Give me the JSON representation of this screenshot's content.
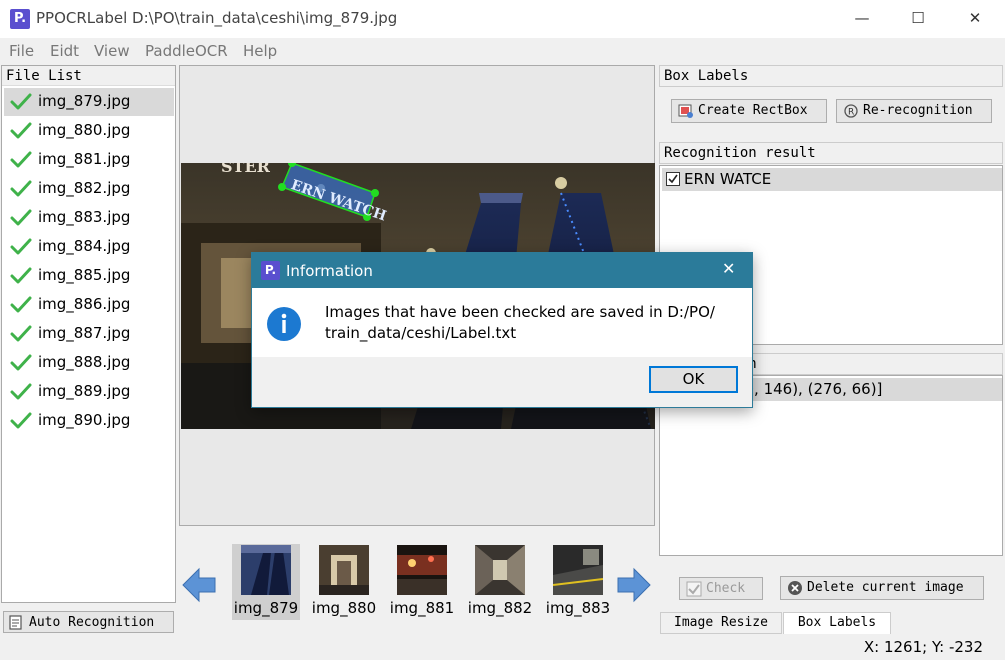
{
  "window": {
    "app_icon_text": "P.",
    "title": "PPOCRLabel D:\\PO\\train_data\\ceshi\\img_879.jpg",
    "minimize": "—",
    "maximize": "☐",
    "close": "✕"
  },
  "menu": [
    "File",
    "Eidt",
    "View",
    "PaddleOCR",
    "Help"
  ],
  "file_list": {
    "header": "File List",
    "items": [
      "img_879.jpg",
      "img_880.jpg",
      "img_881.jpg",
      "img_882.jpg",
      "img_883.jpg",
      "img_884.jpg",
      "img_885.jpg",
      "img_886.jpg",
      "img_887.jpg",
      "img_888.jpg",
      "img_889.jpg",
      "img_890.jpg"
    ],
    "selected_index": 0
  },
  "auto_recognition": "Auto Recognition",
  "canvas": {
    "box_text": "ERN WATCH",
    "sign_text": "STER"
  },
  "thumbnails": {
    "items": [
      "img_879",
      "img_880",
      "img_881",
      "img_882",
      "img_883"
    ],
    "selected_index": 0
  },
  "box_labels": {
    "header": "Box Labels",
    "create_rectbox": "Create RectBox",
    "re_recognition": "Re-recognition"
  },
  "recognition_result": {
    "header": "Recognition result",
    "items": [
      {
        "checked": true,
        "text": "ERN WATCE"
      }
    ]
  },
  "box_position": {
    "header": "ox position",
    "row": "2, 78), (500, 146), (276, 66)]"
  },
  "check_button": "Check",
  "delete_button": "Delete current image",
  "tabs": [
    "Image Resize",
    "Box Labels"
  ],
  "status": "X: 1261; Y: -232",
  "dialog": {
    "icon_text": "P.",
    "title": "Information",
    "close": "✕",
    "message_line1": "Images that have been checked are saved in D:/PO/",
    "message_line2": "train_data/ceshi/Label.txt",
    "ok": "OK"
  },
  "colors": {
    "accent": "#0078d7",
    "dialog_title": "#2b7b9a",
    "check_green": "#3fb24a",
    "box_green": "#22dd22",
    "box_fill": "#3a6fc4"
  }
}
